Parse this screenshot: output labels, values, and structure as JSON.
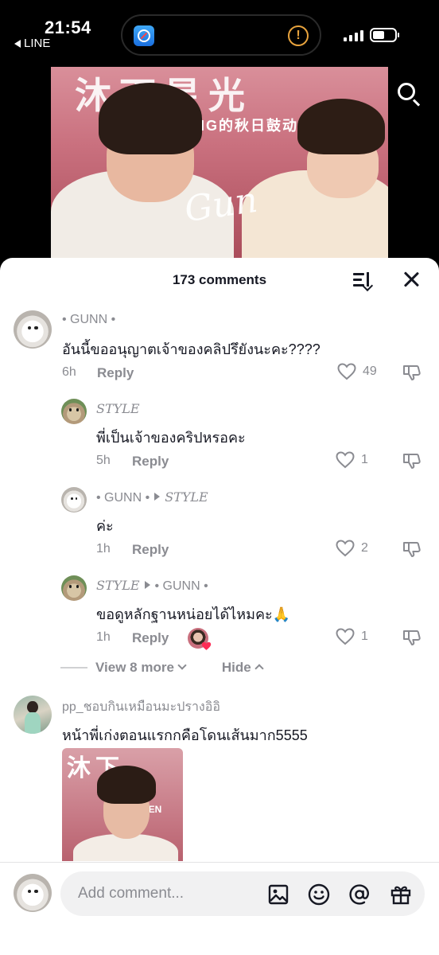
{
  "status_bar": {
    "time": "21:54",
    "back_app": "LINE"
  },
  "video": {
    "banner_text": "沐下星光",
    "banner_subtext": "NG的秋日鼓动",
    "signature": "Gun"
  },
  "sheet": {
    "title": "173 comments"
  },
  "comments": [
    {
      "username": "• GUNN •",
      "text": "อันนี้ขออนุญาตเจ้าของคลิปรึยังนะคะ????",
      "age": "6h",
      "reply_label": "Reply",
      "likes": "49"
    },
    {
      "username": "STYLE",
      "text": "พี่เป็นเจ้าของคริปหรอคะ",
      "age": "5h",
      "reply_label": "Reply",
      "likes": "1"
    },
    {
      "username": "• GUNN •",
      "reply_to": "STYLE",
      "text": "ค่ะ",
      "age": "1h",
      "reply_label": "Reply",
      "likes": "2"
    },
    {
      "username": "STYLE",
      "reply_to": "• GUNN •",
      "text": "ขอดูหลักฐานหน่อยได้ไหมคะ🙏",
      "age": "1h",
      "reply_label": "Reply",
      "likes": "1"
    },
    {
      "username": "pp_ชอบกินเหมือนมะปรางอิอิ",
      "text": "หน้าพี่เก่งตอนแรกกคือโดนเส้นมาก5555"
    }
  ],
  "thread_controls": {
    "view_more": "View 8 more",
    "hide": "Hide"
  },
  "thumbnail": {
    "banner_text": "沐下",
    "side_text": "KEN"
  },
  "input_bar": {
    "placeholder": "Add comment..."
  },
  "icons": {
    "search": "search-icon",
    "sort": "sort-icon",
    "close": "close-icon",
    "heart": "heart-icon",
    "dislike": "dislike-icon",
    "image": "image-icon",
    "emoji": "emoji-icon",
    "mention": "at-icon",
    "gift": "gift-icon"
  },
  "colors": {
    "text": "#161823",
    "muted": "#8a8b91",
    "like_accent": "#fe2c55"
  }
}
